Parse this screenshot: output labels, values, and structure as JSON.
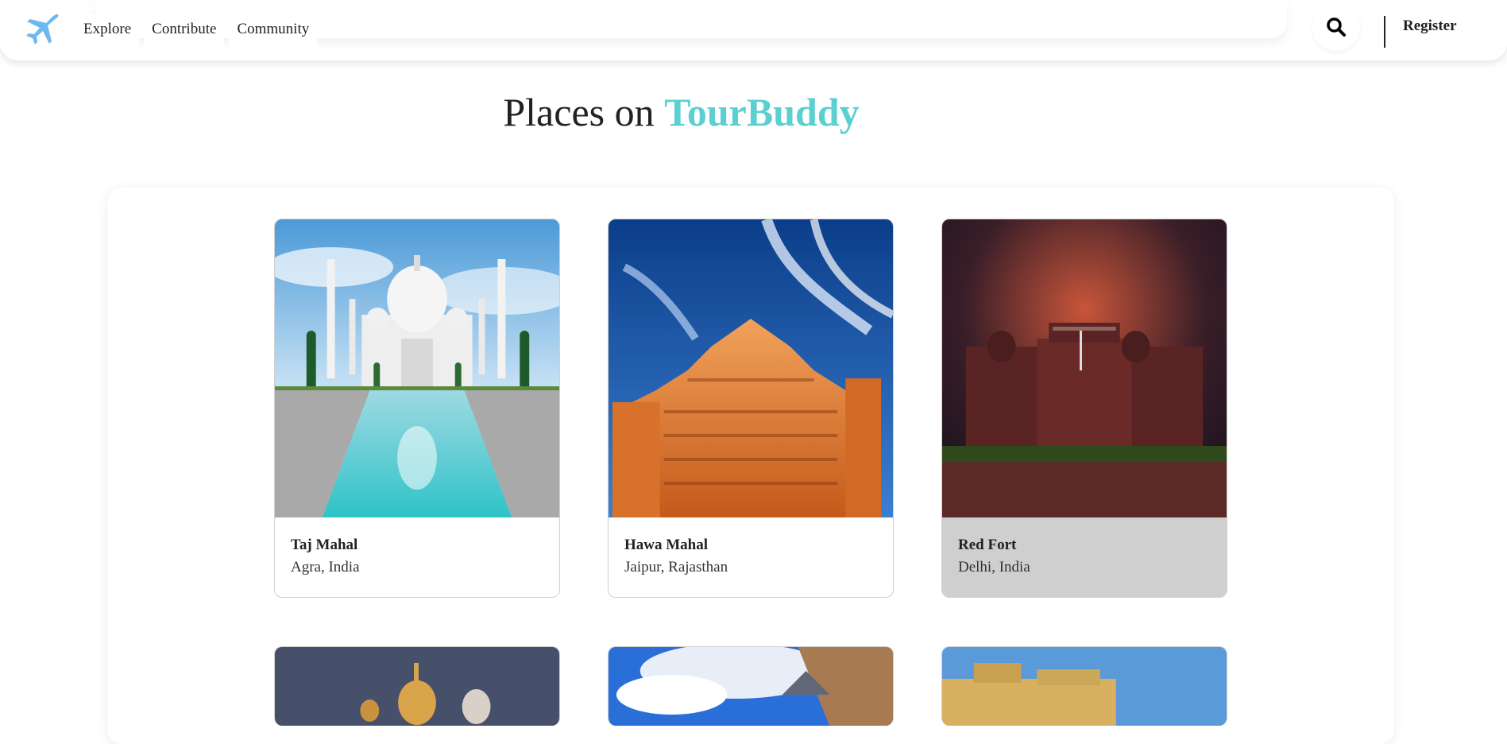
{
  "nav": {
    "links": [
      "Explore",
      "Contribute",
      "Community"
    ],
    "register_label": "Register",
    "logo_icon": "airplane-icon",
    "search_icon": "search-icon",
    "logo_color": "#6cb8f0"
  },
  "heading": {
    "prefix": "Places on ",
    "brand": "TourBuddy",
    "brand_color": "#5ccfd0"
  },
  "places": [
    {
      "name": "Taj Mahal",
      "location": "Agra, India",
      "image": "taj-mahal-photo"
    },
    {
      "name": "Hawa Mahal",
      "location": "Jaipur, Rajasthan",
      "image": "hawa-mahal-photo"
    },
    {
      "name": "Red Fort",
      "location": "Delhi, India",
      "image": "red-fort-photo"
    }
  ],
  "places_row2_images": [
    "golden-temple-photo",
    "mountain-valley-photo",
    "amber-fort-photo"
  ]
}
